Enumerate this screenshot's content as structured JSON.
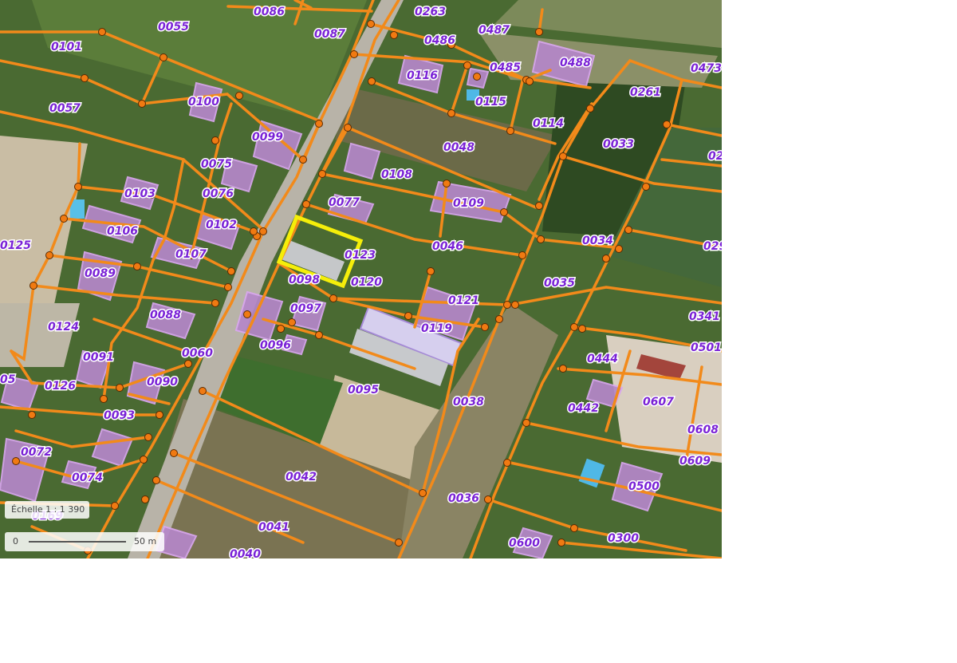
{
  "map": {
    "scale_text": "Échelle 1 : 1 390",
    "scale_bar_start": "0",
    "scale_bar_end": "50 m",
    "colors": {
      "boundary": "#f28a1a",
      "label": "#7a22d6",
      "selection": "#f5ee0a",
      "building": "#b587c9"
    },
    "selected_parcel": "0123",
    "parcels": [
      "0086",
      "0263",
      "0055",
      "0087",
      "0486",
      "0487",
      "0101",
      "0488",
      "0473",
      "0485",
      "0116",
      "0100",
      "0057",
      "0115",
      "0261",
      "0114",
      "0099",
      "0033",
      "0048",
      "0075",
      "0108",
      "0103",
      "0076",
      "0077",
      "0109",
      "0106",
      "0102",
      "0125",
      "0107",
      "0034",
      "0046",
      "0123",
      "0089",
      "0098",
      "0120",
      "0035",
      "0121",
      "0097",
      "0088",
      "0341",
      "0124",
      "0119",
      "0096",
      "0501",
      "0060",
      "0091",
      "0444",
      "0090",
      "0126",
      "0095",
      "0038",
      "0607",
      "0442",
      "0093",
      "0608",
      "0072",
      "0609",
      "0074",
      "0042",
      "0500",
      "0036",
      "0169",
      "0041",
      "0300",
      "0600",
      "0040",
      "05",
      "02",
      "029"
    ]
  }
}
